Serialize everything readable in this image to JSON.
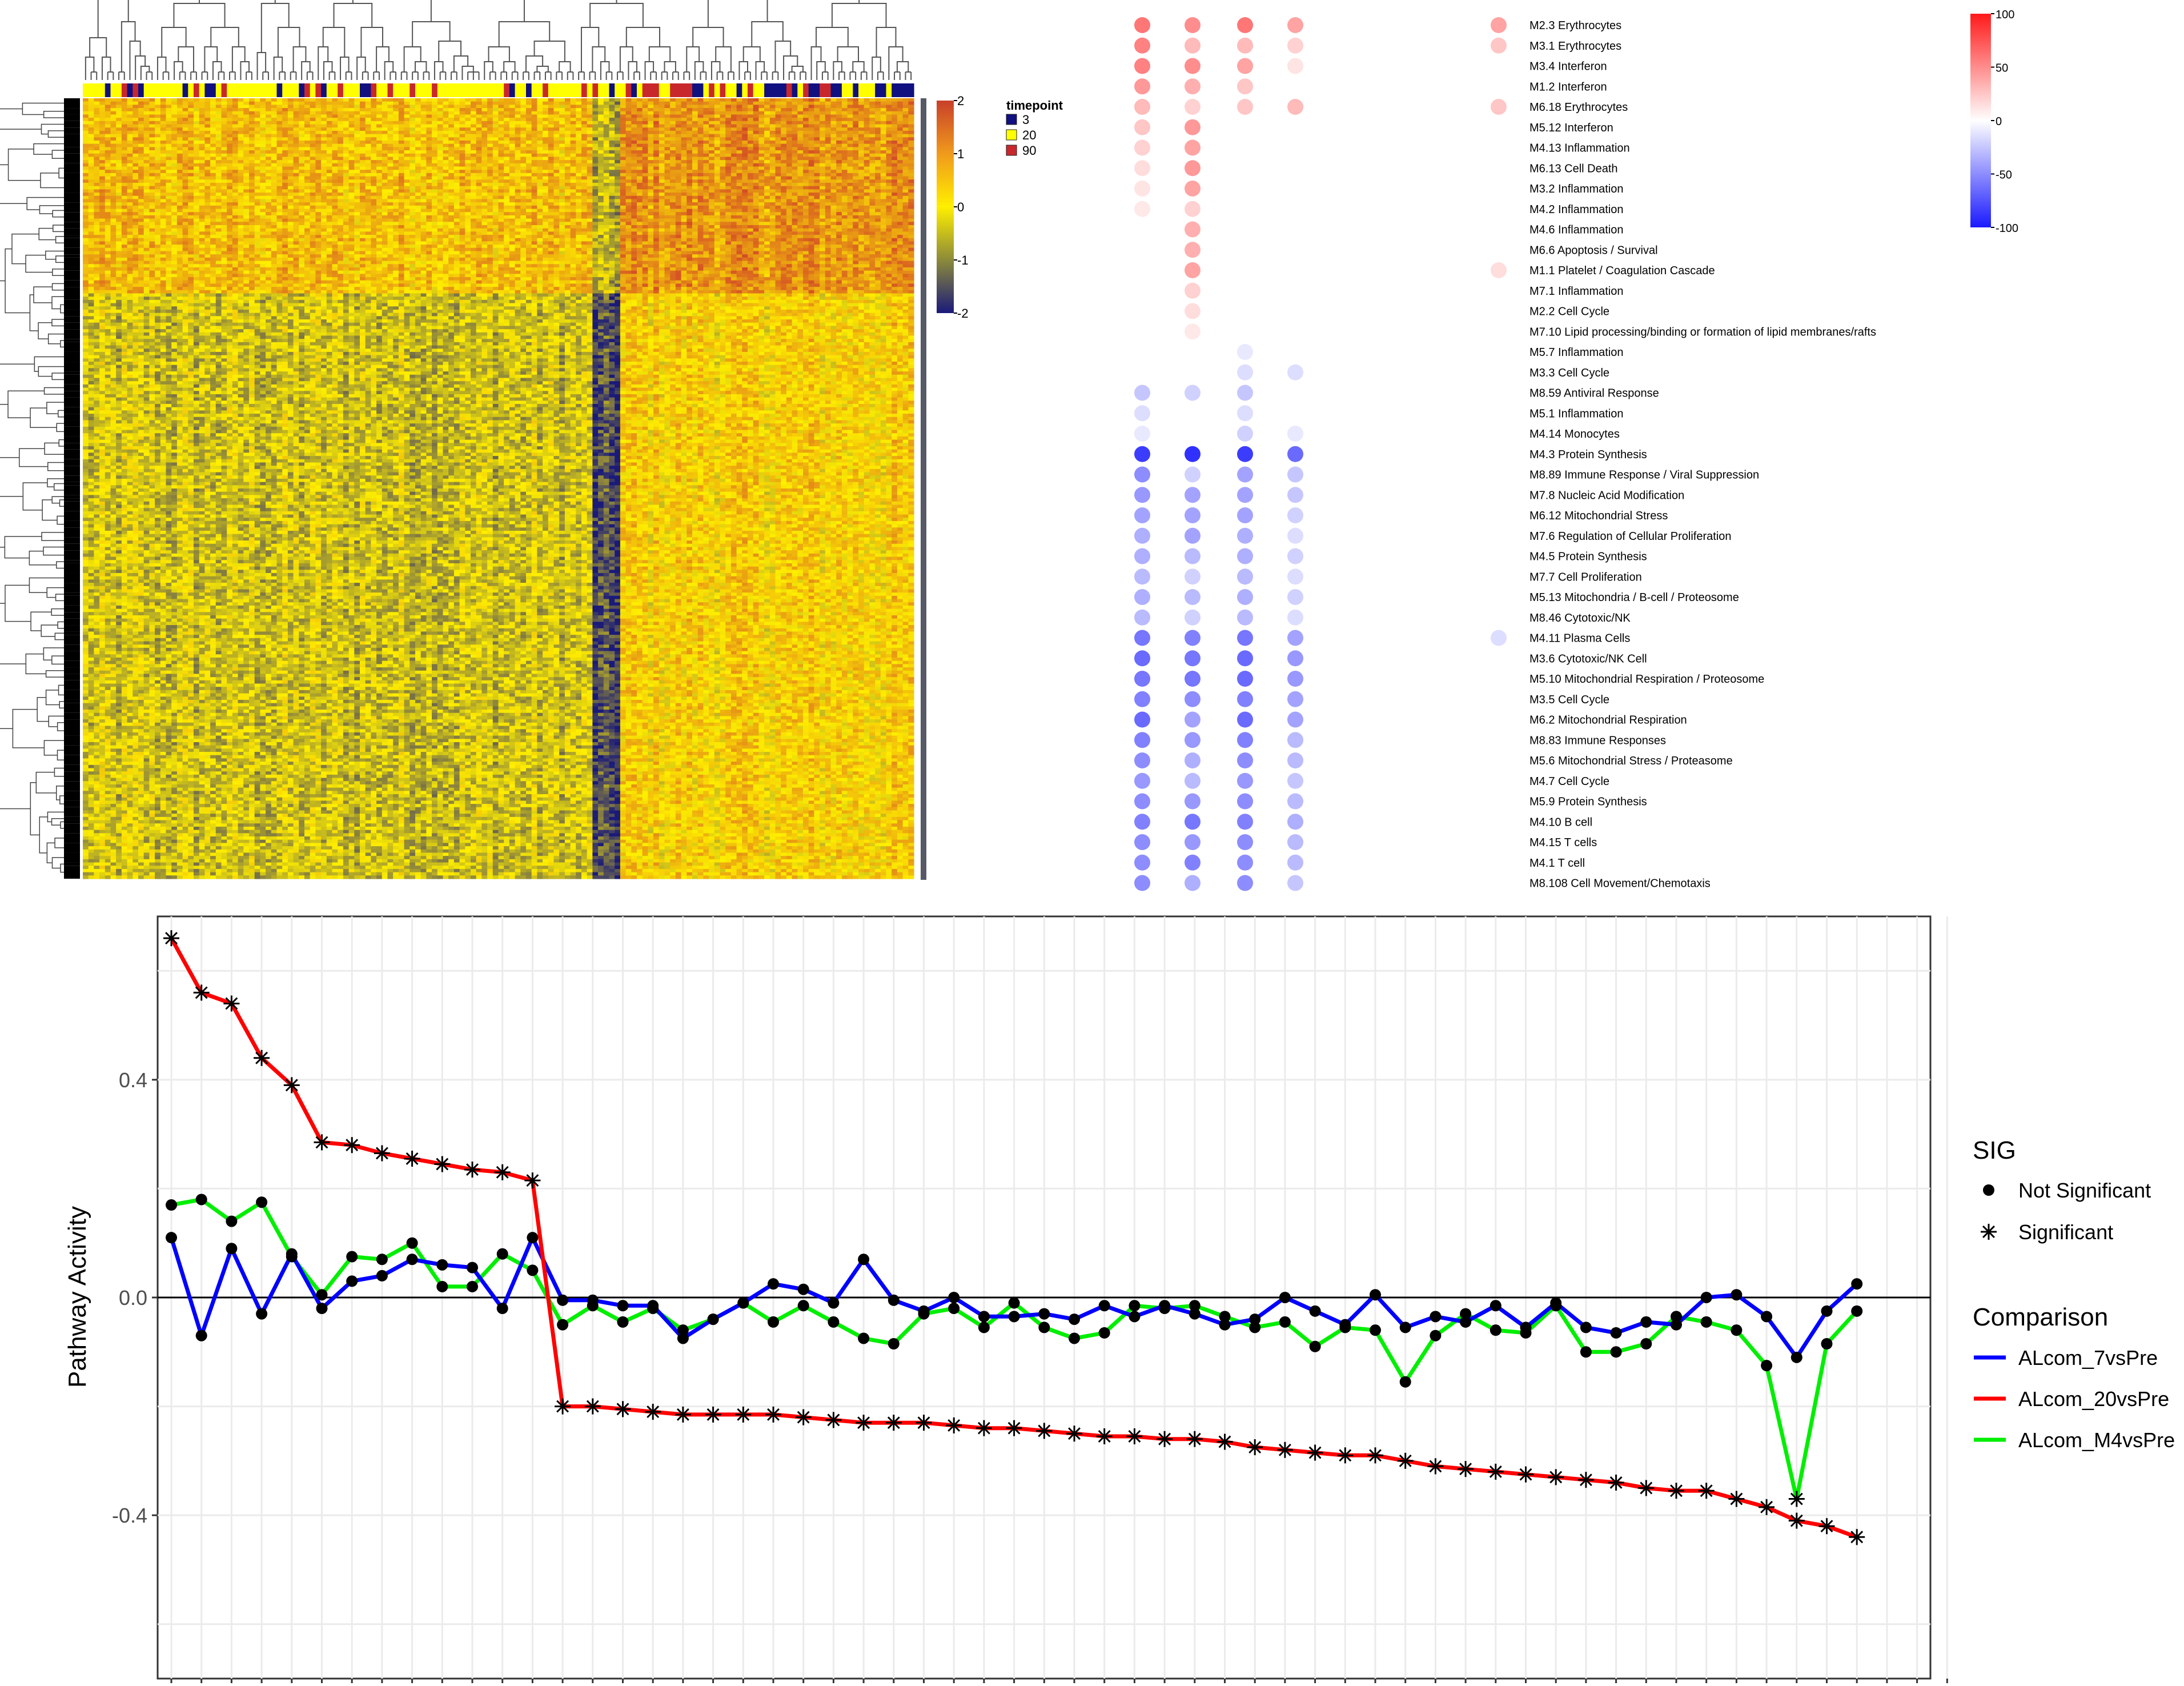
{
  "colors": {
    "heat_low": "#1a1a7a",
    "heat_mid": "#ffff00",
    "heat_high": "#e34a1f",
    "tp_3": "#101080",
    "tp_20": "#ffff00",
    "tp_90": "#c8282c",
    "dot_pos": "#ff2020",
    "dot_neg": "#2020ff",
    "line_7": "#0000ff",
    "line_20": "#ff0000",
    "line_m4": "#00ee00"
  },
  "heatmap": {
    "legend_title": "timepoint",
    "legend_items": [
      {
        "label": "3",
        "color": "#101080"
      },
      {
        "label": "20",
        "color": "#ffff00"
      },
      {
        "label": "90",
        "color": "#c8282c"
      }
    ],
    "scale_ticks": [
      "2",
      "1",
      "0",
      "-1",
      "-2"
    ],
    "n_columns": 150,
    "n_rows": 240
  },
  "modules": {
    "scale_ticks": [
      "100",
      "50",
      "0",
      "-50",
      "-100"
    ],
    "labels": [
      "M2.3 Erythrocytes",
      "M3.1 Erythrocytes",
      "M3.4 Interferon",
      "M1.2 Interferon",
      "M6.18 Erythrocytes",
      "M5.12 Interferon",
      "M4.13 Inflammation",
      "M6.13 Cell Death",
      "M3.2 Inflammation",
      "M4.2 Inflammation",
      "M4.6 Inflammation",
      "M6.6 Apoptosis / Survival",
      "M1.1 Platelet / Coagulation Cascade",
      "M7.1 Inflammation",
      "M2.2 Cell Cycle",
      "M7.10 Lipid processing/binding or formation of lipid membranes/rafts",
      "M5.7 Inflammation",
      "M3.3 Cell Cycle",
      "M8.59 Antiviral Response",
      "M5.1 Inflammation",
      "M4.14 Monocytes",
      "M4.3 Protein Synthesis",
      "M8.89 Immune Response / Viral Suppression",
      "M7.8 Nucleic Acid Modification",
      "M6.12 Mitochondrial Stress",
      "M7.6 Regulation of Cellular Proliferation",
      "M4.5 Protein Synthesis",
      "M7.7 Cell Proliferation",
      "M5.13 Mitochondria / B-cell / Proteosome",
      "M8.46 Cytotoxic/NK",
      "M4.11 Plasma Cells",
      "M3.6 Cytotoxic/NK Cell",
      "M5.10 Mitochondrial Respiration / Proteosome",
      "M3.5 Cell Cycle",
      "M6.2 Mitochondrial Respiration",
      "M8.83 Immune Responses",
      "M5.6 Mitochondrial Stress / Proteasome",
      "M4.7 Cell Cycle",
      "M5.9 Protein Synthesis",
      "M4.10 B cell",
      "M4.15 T cells",
      "M4.1 T cell",
      "M8.108 Cell Movement/Chemotaxis"
    ],
    "dot_values": [
      [
        60,
        50,
        60,
        40,
        40
      ],
      [
        55,
        30,
        30,
        20,
        25
      ],
      [
        55,
        50,
        40,
        12,
        0
      ],
      [
        45,
        35,
        25,
        0,
        0
      ],
      [
        30,
        20,
        25,
        30,
        25
      ],
      [
        25,
        45,
        0,
        0,
        0
      ],
      [
        20,
        40,
        0,
        0,
        0
      ],
      [
        15,
        45,
        0,
        0,
        0
      ],
      [
        12,
        40,
        0,
        0,
        0
      ],
      [
        10,
        20,
        0,
        0,
        0
      ],
      [
        0,
        35,
        0,
        0,
        0
      ],
      [
        0,
        35,
        0,
        0,
        0
      ],
      [
        0,
        40,
        0,
        0,
        15
      ],
      [
        0,
        20,
        0,
        0,
        0
      ],
      [
        0,
        15,
        0,
        0,
        0
      ],
      [
        0,
        10,
        0,
        0,
        0
      ],
      [
        0,
        0,
        -10,
        0,
        0
      ],
      [
        0,
        0,
        -15,
        -15,
        0
      ],
      [
        -25,
        -20,
        -25,
        0,
        0
      ],
      [
        -15,
        0,
        -15,
        0,
        0
      ],
      [
        -10,
        0,
        -20,
        -10,
        0
      ],
      [
        -85,
        -90,
        -85,
        -65,
        0
      ],
      [
        -50,
        -20,
        -40,
        -25,
        0
      ],
      [
        -45,
        -40,
        -40,
        -25,
        0
      ],
      [
        -40,
        -40,
        -40,
        -20,
        0
      ],
      [
        -35,
        -40,
        -35,
        -15,
        0
      ],
      [
        -35,
        -30,
        -35,
        -20,
        0
      ],
      [
        -30,
        -20,
        -30,
        -15,
        0
      ],
      [
        -35,
        -30,
        -35,
        -20,
        0
      ],
      [
        -30,
        -20,
        -30,
        -15,
        0
      ],
      [
        -60,
        -55,
        -60,
        -40,
        -15
      ],
      [
        -65,
        -60,
        -65,
        -45,
        0
      ],
      [
        -60,
        -60,
        -65,
        -45,
        0
      ],
      [
        -55,
        -50,
        -55,
        -40,
        0
      ],
      [
        -65,
        -40,
        -65,
        -40,
        0
      ],
      [
        -55,
        -45,
        -55,
        -30,
        0
      ],
      [
        -50,
        -35,
        -50,
        -30,
        0
      ],
      [
        -45,
        -30,
        -45,
        -25,
        0
      ],
      [
        -50,
        -45,
        -50,
        -30,
        0
      ],
      [
        -55,
        -60,
        -55,
        -35,
        0
      ],
      [
        -50,
        -45,
        -50,
        -30,
        0
      ],
      [
        -50,
        -55,
        -50,
        -30,
        0
      ],
      [
        -50,
        -35,
        -50,
        -25,
        0
      ]
    ]
  },
  "chart_data": {
    "type": "line",
    "xlabel": "",
    "ylabel": "Pathway Activity",
    "ylim": [
      -0.7,
      0.7
    ],
    "yticks": [
      0.4,
      0.0,
      -0.4
    ],
    "ytick_labels": [
      "0.4",
      "0.0",
      "-0.4"
    ],
    "x": [
      1,
      2,
      3,
      4,
      5,
      6,
      7,
      8,
      9,
      10,
      11,
      12,
      13,
      14,
      15,
      16,
      17,
      18,
      19,
      20,
      21,
      22,
      23,
      24,
      25,
      26,
      27,
      28,
      29,
      30,
      31,
      32,
      33,
      34,
      35,
      36,
      37,
      38,
      39,
      40,
      41,
      42,
      43,
      44,
      45,
      46,
      47,
      48,
      49,
      50,
      51,
      52,
      53,
      54,
      55,
      56,
      57,
      58,
      59,
      60
    ],
    "hline": 0,
    "legend": {
      "sig_title": "SIG",
      "sig_items": [
        "Not Significant",
        "Significant"
      ],
      "cmp_title": "Comparison",
      "cmp_items": [
        "ALcom_7vsPre",
        "ALcom_20vsPre",
        "ALcom_M4vsPre"
      ]
    },
    "series": [
      {
        "name": "ALcom_7vsPre",
        "color": "#0000ff",
        "values": [
          0.11,
          -0.07,
          0.09,
          -0.03,
          0.08,
          -0.02,
          0.03,
          0.04,
          0.07,
          0.06,
          0.055,
          -0.02,
          0.11,
          -0.005,
          -0.005,
          -0.015,
          -0.015,
          -0.075,
          -0.04,
          -0.01,
          0.025,
          0.015,
          -0.01,
          0.07,
          -0.005,
          -0.025,
          0.0,
          -0.035,
          -0.035,
          -0.03,
          -0.04,
          -0.015,
          -0.035,
          -0.015,
          -0.03,
          -0.05,
          -0.04,
          0.0,
          -0.025,
          -0.05,
          0.005,
          -0.055,
          -0.035,
          -0.045,
          -0.015,
          -0.055,
          -0.01,
          -0.055,
          -0.065,
          -0.045,
          -0.05,
          0.0,
          0.005,
          -0.035,
          -0.11,
          -0.025,
          0.025
        ],
        "significant": []
      },
      {
        "name": "ALcom_20vsPre",
        "color": "#ff0000",
        "values": [
          0.66,
          0.56,
          0.54,
          0.44,
          0.39,
          0.285,
          0.28,
          0.265,
          0.255,
          0.245,
          0.235,
          0.23,
          0.215,
          -0.2,
          -0.2,
          -0.205,
          -0.21,
          -0.215,
          -0.215,
          -0.215,
          -0.215,
          -0.22,
          -0.225,
          -0.23,
          -0.23,
          -0.23,
          -0.235,
          -0.24,
          -0.24,
          -0.245,
          -0.25,
          -0.255,
          -0.255,
          -0.26,
          -0.26,
          -0.265,
          -0.275,
          -0.28,
          -0.285,
          -0.29,
          -0.29,
          -0.3,
          -0.31,
          -0.315,
          -0.32,
          -0.325,
          -0.33,
          -0.335,
          -0.34,
          -0.35,
          -0.355,
          -0.355,
          -0.37,
          -0.385,
          -0.41,
          -0.42,
          -0.44
        ],
        "significant": "all"
      },
      {
        "name": "ALcom_M4vsPre",
        "color": "#00ee00",
        "values": [
          0.17,
          0.18,
          0.14,
          0.175,
          0.075,
          0.005,
          0.075,
          0.07,
          0.1,
          0.02,
          0.02,
          0.08,
          0.05,
          -0.05,
          -0.015,
          -0.045,
          -0.02,
          -0.06,
          -0.04,
          -0.01,
          -0.045,
          -0.015,
          -0.045,
          -0.075,
          -0.085,
          -0.03,
          -0.02,
          -0.055,
          -0.01,
          -0.055,
          -0.075,
          -0.065,
          -0.015,
          -0.02,
          -0.015,
          -0.035,
          -0.055,
          -0.045,
          -0.09,
          -0.055,
          -0.06,
          -0.155,
          -0.07,
          -0.03,
          -0.06,
          -0.065,
          -0.015,
          -0.1,
          -0.1,
          -0.085,
          -0.035,
          -0.045,
          -0.06,
          -0.125,
          -0.37,
          -0.085,
          -0.025
        ],
        "significant": [
          55
        ]
      }
    ]
  }
}
